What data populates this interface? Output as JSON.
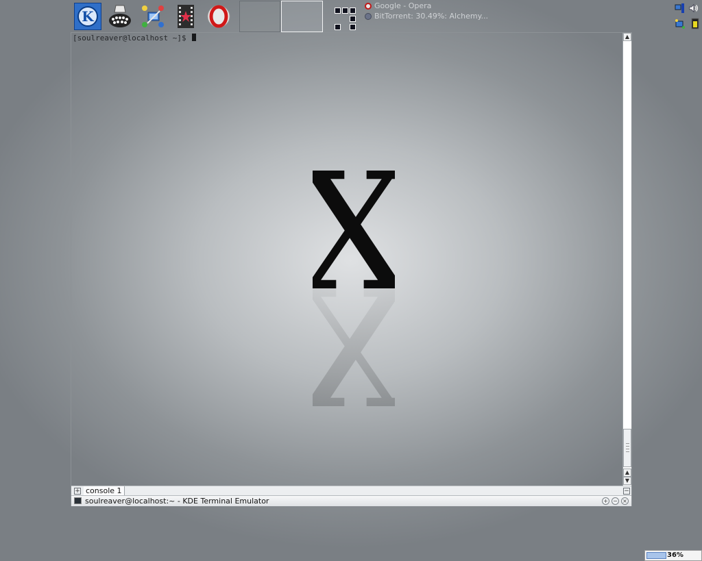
{
  "panel": {
    "launchers": [
      {
        "name": "kde-menu",
        "icon": "kde-logo-icon"
      },
      {
        "name": "kwrite",
        "icon": "typewriter-icon"
      },
      {
        "name": "network",
        "icon": "network-computers-icon"
      },
      {
        "name": "media-player",
        "icon": "film-star-icon"
      },
      {
        "name": "opera",
        "icon": "opera-icon"
      }
    ],
    "taskbar": [
      {
        "label": "Google - Opera",
        "icon": "opera-icon"
      },
      {
        "label": "BitTorrent: 30.49%: Alchemy...",
        "icon": "bittorrent-icon"
      }
    ],
    "tray": [
      "network-icon",
      "volume-icon",
      "network-manager-icon",
      "battery-icon"
    ]
  },
  "terminal": {
    "prompt": "[soulreaver@localhost ~]$ ",
    "tab_label": "console 1",
    "window_title": "soulreaver@localhost:~ - KDE Terminal Emulator",
    "wallpaper_letter": "X"
  },
  "battery": {
    "percent_label": "36%",
    "level": 0.36
  },
  "colors": {
    "accent": "#2f6fc8",
    "wallpaper": "#b9bdc0"
  }
}
